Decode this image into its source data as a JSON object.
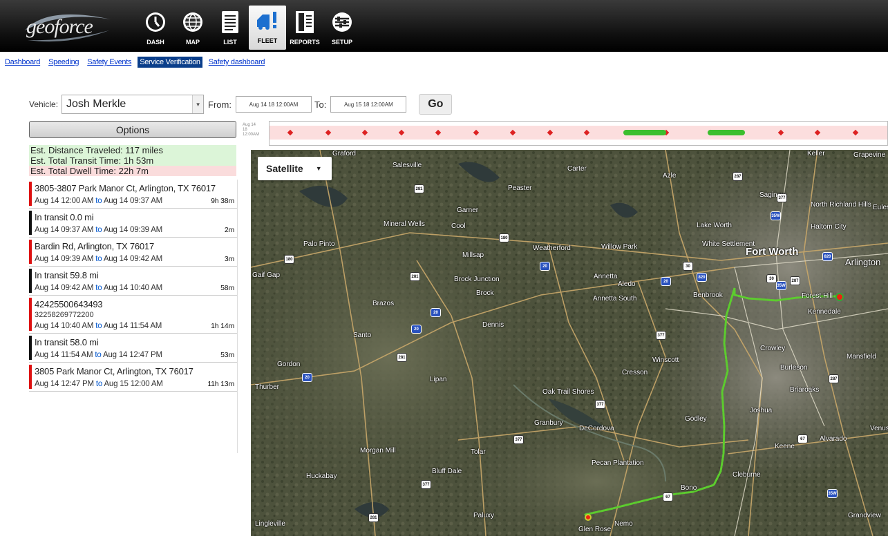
{
  "app": {
    "logo_text": "geoforce"
  },
  "nav": [
    {
      "label": "DASH",
      "icon": "dashboard-gauge-icon"
    },
    {
      "label": "MAP",
      "icon": "globe-icon"
    },
    {
      "label": "LIST",
      "icon": "list-document-icon"
    },
    {
      "label": "FLEET",
      "icon": "truck-alert-icon",
      "active": true
    },
    {
      "label": "REPORTS",
      "icon": "reports-book-icon"
    },
    {
      "label": "SETUP",
      "icon": "setup-sliders-icon"
    }
  ],
  "subtabs": [
    {
      "label": "Dashboard"
    },
    {
      "label": "Speeding"
    },
    {
      "label": "Safety Events"
    },
    {
      "label": "Service Verification",
      "active": true
    },
    {
      "label": "Safety dashboard"
    }
  ],
  "filter": {
    "vehicle_label": "Vehicle:",
    "vehicle_value": "Josh Merkle",
    "from_label": "From:",
    "from_value": "Aug 14 18 12:00AM",
    "to_label": "To:",
    "to_value": "Aug 15 18 12:00AM",
    "go_label": "Go"
  },
  "options_label": "Options",
  "summary": {
    "distance": "Est. Distance Traveled: 117 miles",
    "transit": "Est. Total Transit Time: 1h 53m",
    "dwell": "Est. Total Dwell Time: 22h 7m"
  },
  "events": [
    {
      "type": "stop",
      "title": "3805-3807 Park Manor Ct, Arlington, TX 76017",
      "start": "Aug 14 12:00 AM",
      "end": "Aug 14 09:37 AM",
      "duration": "9h 38m"
    },
    {
      "type": "transit",
      "title": "In transit 0.0 mi",
      "start": "Aug 14 09:37 AM",
      "end": "Aug 14 09:39 AM",
      "duration": "2m"
    },
    {
      "type": "stop",
      "title": "Bardin Rd, Arlington, TX 76017",
      "start": "Aug 14 09:39 AM",
      "end": "Aug 14 09:42 AM",
      "duration": "3m"
    },
    {
      "type": "transit",
      "title": "In transit 59.8 mi",
      "start": "Aug 14 09:42 AM",
      "end": "Aug 14 10:40 AM",
      "duration": "58m"
    },
    {
      "type": "stop",
      "title": "42425500643493",
      "subtitle": "32258269772200",
      "start": "Aug 14 10:40 AM",
      "end": "Aug 14 11:54 AM",
      "duration": "1h 14m"
    },
    {
      "type": "transit",
      "title": "In transit 58.0 mi",
      "start": "Aug 14 11:54 AM",
      "end": "Aug 14 12:47 PM",
      "duration": "53m"
    },
    {
      "type": "stop",
      "title": "3805 Park Manor Ct, Arlington, TX 76017",
      "start": "Aug 14 12:47 PM",
      "end": "Aug 15 12:00 AM",
      "duration": "11h 13m"
    }
  ],
  "event_to_word": "to",
  "timeline": {
    "start_label": "Aug 14",
    "start_sub": "18",
    "start_time": "12:00AM"
  },
  "map": {
    "type_label": "Satellite",
    "towns": [
      "Graford",
      "Salesville",
      "Peaster",
      "Carter",
      "Azle",
      "Keller",
      "Grapevine",
      "Saginaw",
      "North Richland Hills",
      "Euless",
      "Garner",
      "Mineral Wells",
      "Cool",
      "Lake Worth",
      "Haltom City",
      "Palo Pinto",
      "Millsap",
      "Weatherford",
      "Willow Park",
      "White Settlement",
      "Fort Worth",
      "Arlington",
      "Gaif Gap",
      "Brock Junction",
      "Brock",
      "Annetta",
      "Aledo",
      "Annetta South",
      "Benbrook",
      "Forest Hill",
      "Kennedale",
      "Brazos",
      "Dennis",
      "Santo",
      "Crowley",
      "Mansfield",
      "Gordon",
      "Winscott",
      "Burleson",
      "Thurber",
      "Cresson",
      "Lipan",
      "Briaroaks",
      "Oak Trail Shores",
      "Granbury",
      "DeCordova",
      "Godley",
      "Joshua",
      "Venus",
      "Keene",
      "Alvarado",
      "Morgan Mill",
      "Tolar",
      "Pecan Plantation",
      "Huckabay",
      "Bluff Dale",
      "Cleburne",
      "Bono",
      "Paluxy",
      "Nemo",
      "Grandview",
      "Glen Rose",
      "Lingleville"
    ]
  },
  "colors": {
    "stop_bar": "#dd1111",
    "transit_bar": "#111111",
    "route": "#5ccc2e",
    "active_subtab": "#0a3e8a"
  }
}
